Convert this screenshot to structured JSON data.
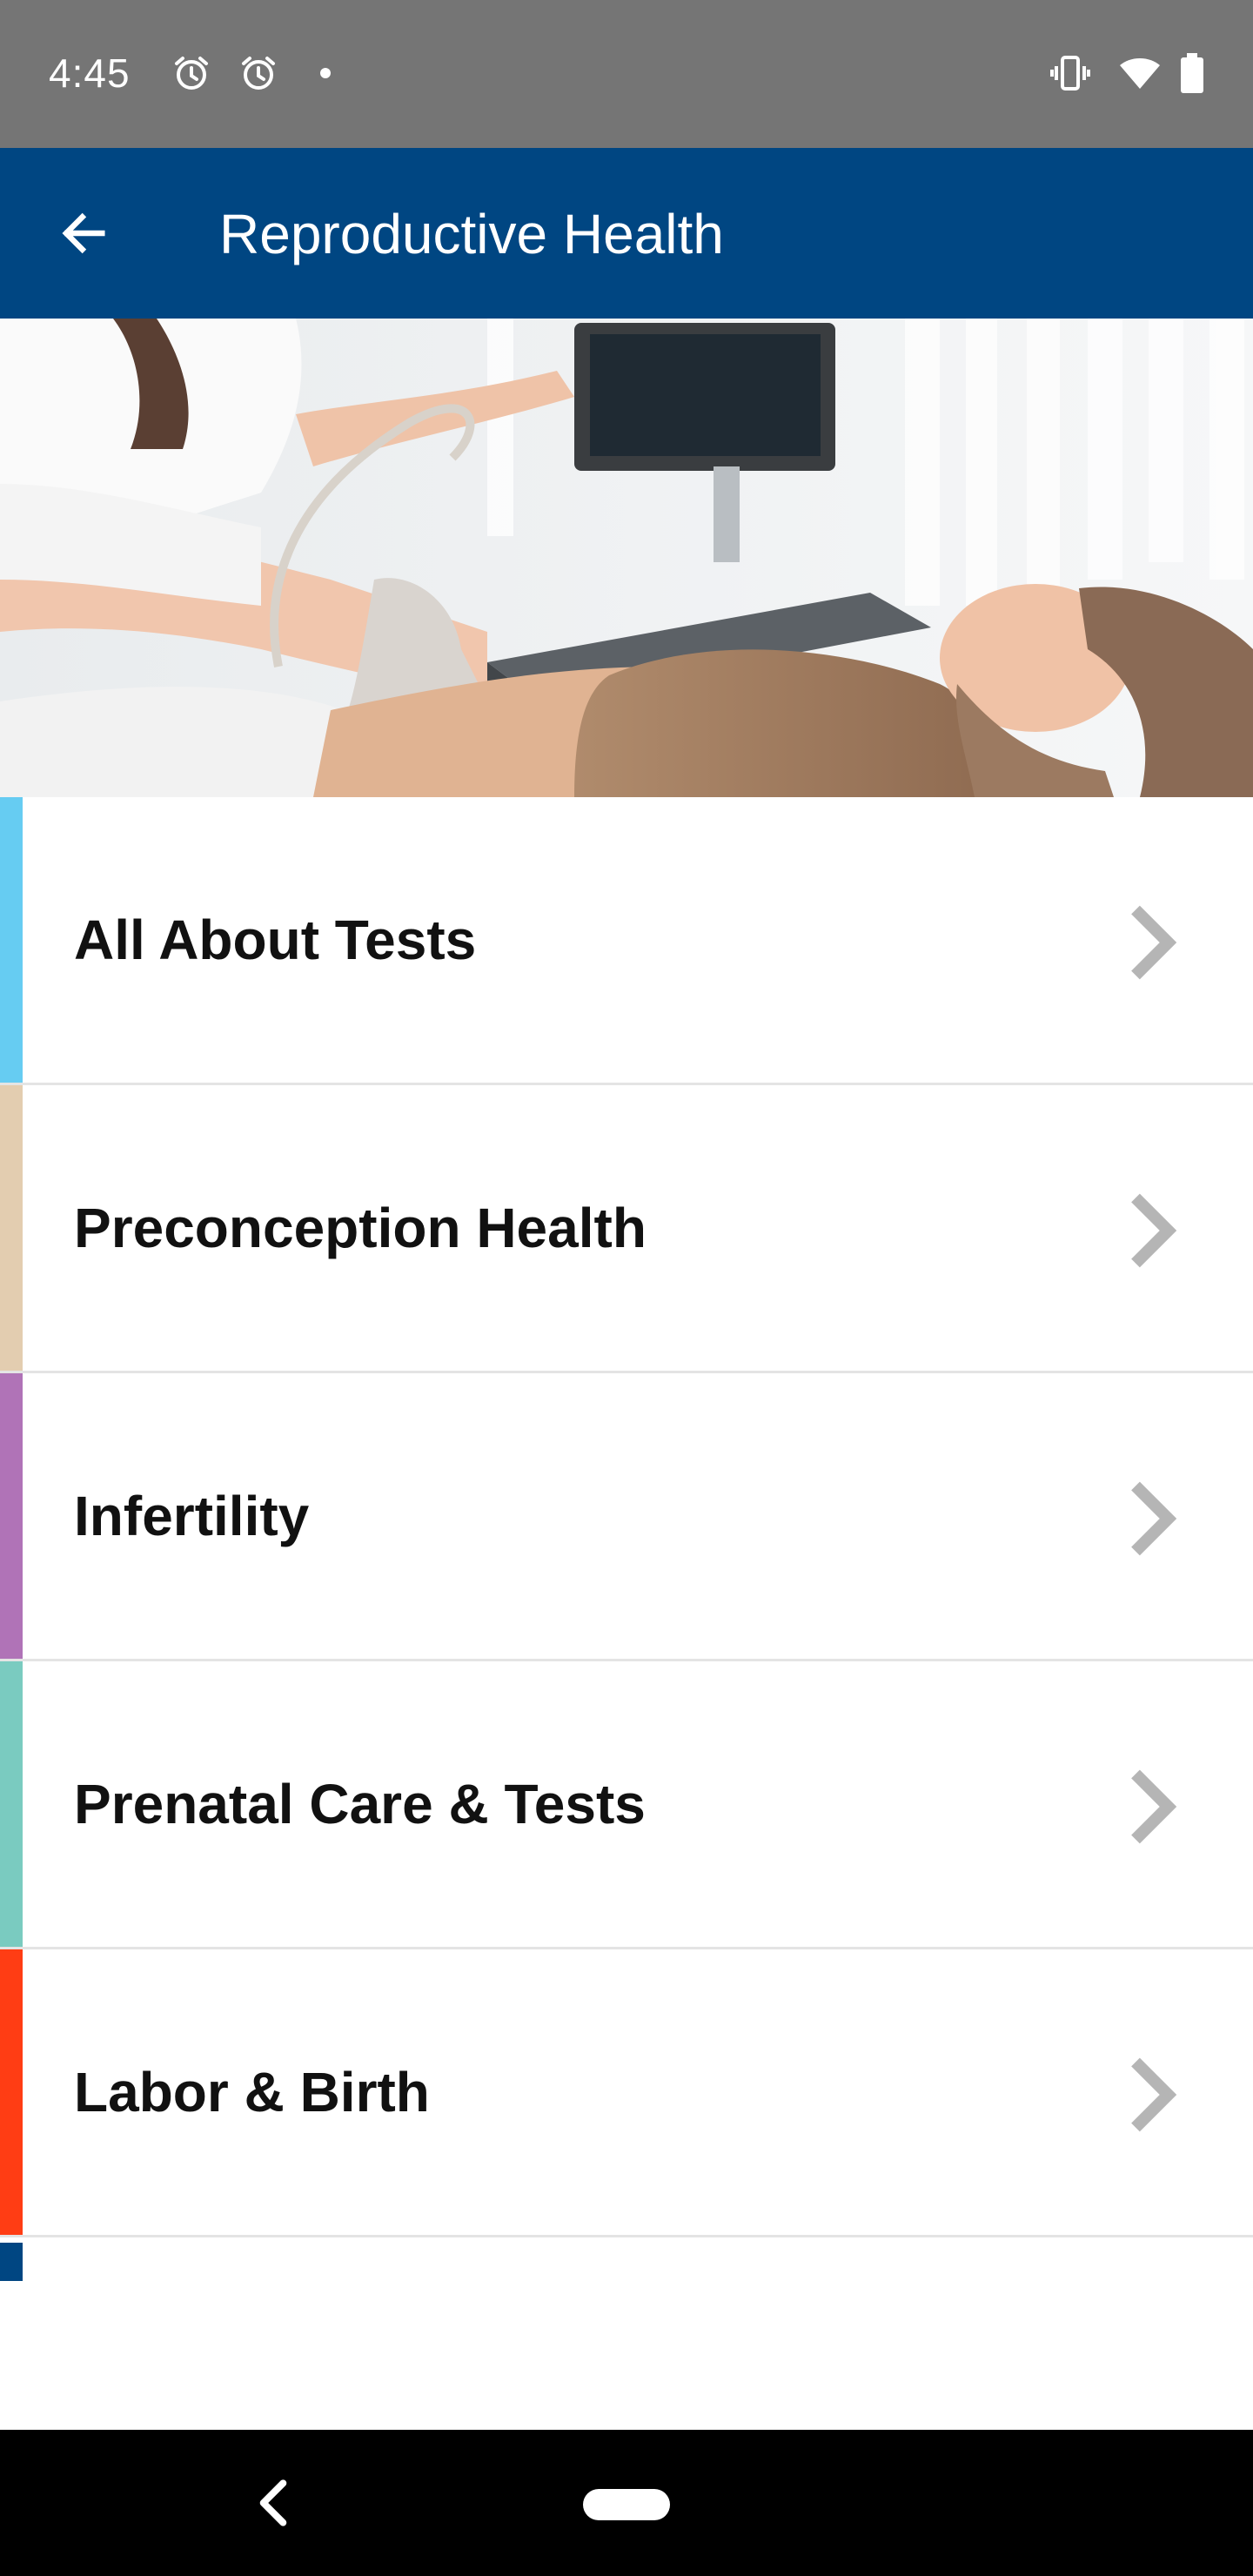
{
  "status_bar": {
    "time": "4:45",
    "left_icons": [
      "alarm-icon",
      "alarm-icon",
      "notification-dot-icon"
    ],
    "right_icons": [
      "vibrate-icon",
      "wifi-icon",
      "battery-icon"
    ]
  },
  "app_bar": {
    "title": "Reproductive Health",
    "back_icon": "arrow-left-icon",
    "background_color": "#004682"
  },
  "hero": {
    "description_icon": "ultrasound-photo"
  },
  "topics": [
    {
      "label": "All About Tests",
      "accent_color": "#66ccf2"
    },
    {
      "label": "Preconception Health",
      "accent_color": "#e3cdb0"
    },
    {
      "label": "Infertility",
      "accent_color": "#b073b7"
    },
    {
      "label": "Prenatal Care & Tests",
      "accent_color": "#7acbc0"
    },
    {
      "label": "Labor & Birth",
      "accent_color": "#ff3d14"
    }
  ],
  "partial_item_accent_color": "#004682",
  "nav_bar": {
    "back_icon": "nav-back-icon",
    "home_icon": "nav-home-pill"
  }
}
